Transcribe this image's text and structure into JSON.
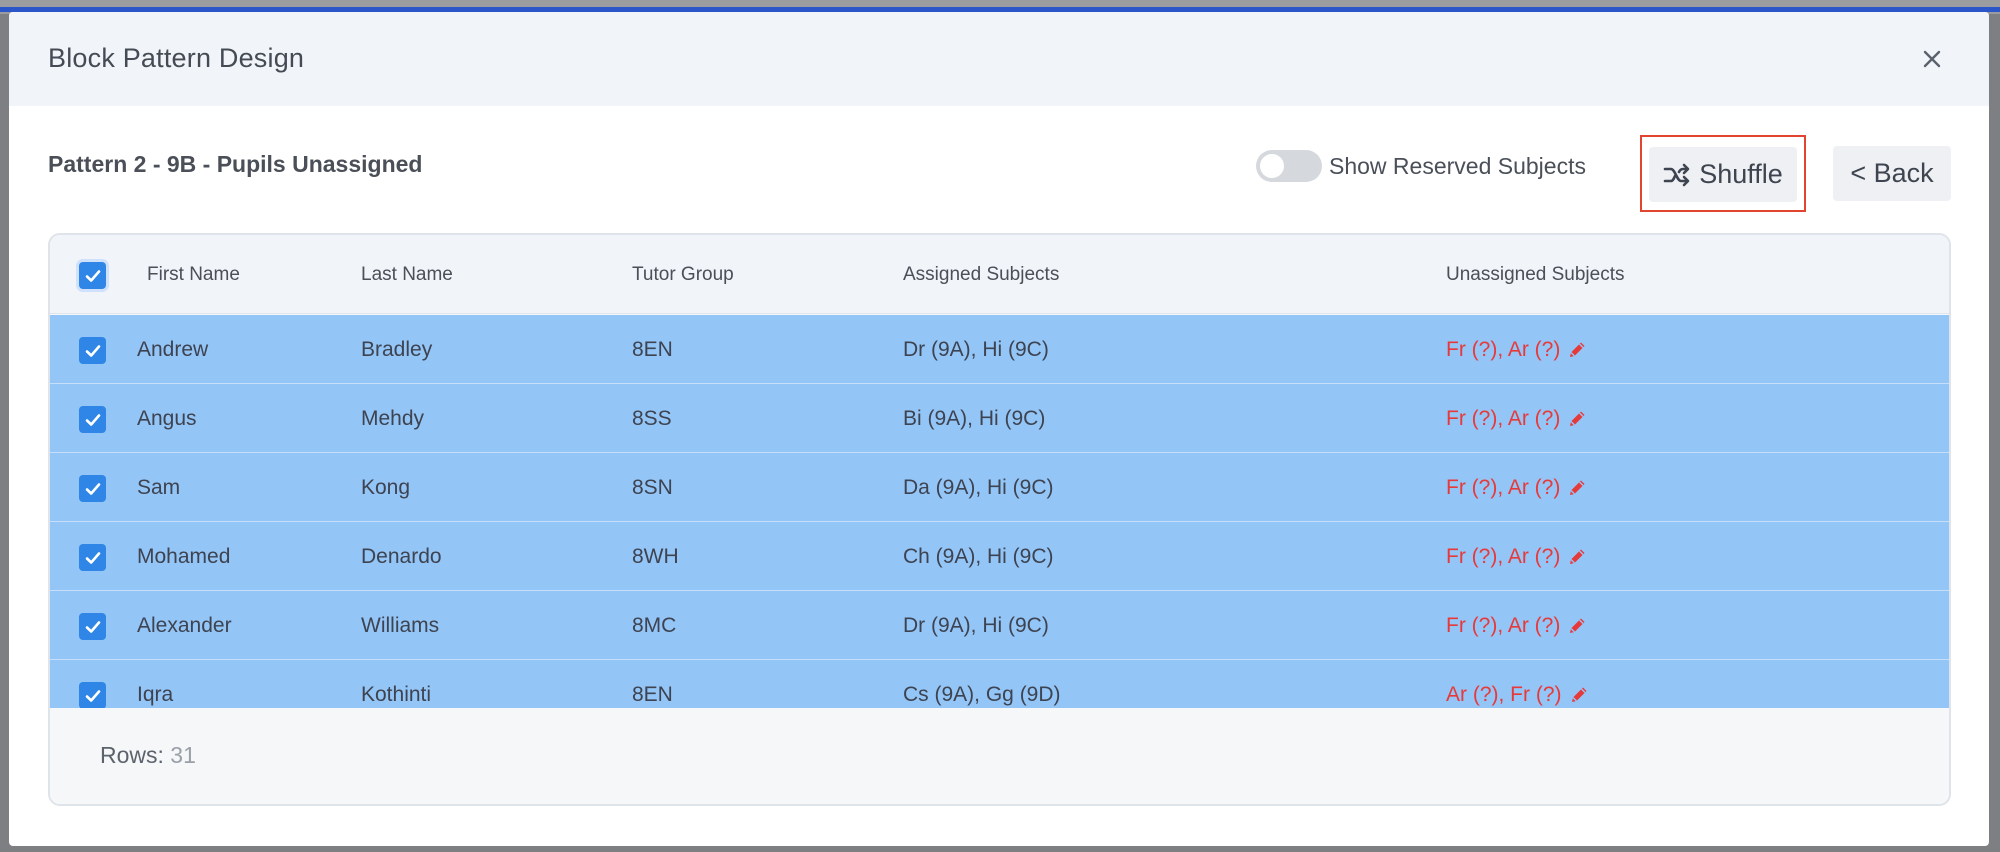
{
  "modal": {
    "title": "Block Pattern Design",
    "subtitle": "Pattern 2 - 9B - Pupils Unassigned",
    "toggle_label": "Show Reserved Subjects",
    "shuffle_label": "Shuffle",
    "back_label": "< Back"
  },
  "table": {
    "headers": {
      "first_name": "First Name",
      "last_name": "Last Name",
      "tutor_group": "Tutor Group",
      "assigned": "Assigned Subjects",
      "unassigned": "Unassigned Subjects"
    },
    "rows": [
      {
        "first": "Andrew",
        "last": "Bradley",
        "tutor": "8EN",
        "assigned": "Dr (9A), Hi (9C)",
        "unassigned": "Fr (?), Ar (?)"
      },
      {
        "first": "Angus",
        "last": "Mehdy",
        "tutor": "8SS",
        "assigned": "Bi (9A), Hi (9C)",
        "unassigned": "Fr (?), Ar (?)"
      },
      {
        "first": "Sam",
        "last": "Kong",
        "tutor": "8SN",
        "assigned": "Da (9A), Hi (9C)",
        "unassigned": "Fr (?), Ar (?)"
      },
      {
        "first": "Mohamed",
        "last": "Denardo",
        "tutor": "8WH",
        "assigned": "Ch (9A), Hi (9C)",
        "unassigned": "Fr (?), Ar (?)"
      },
      {
        "first": "Alexander",
        "last": "Williams",
        "tutor": "8MC",
        "assigned": "Dr (9A), Hi (9C)",
        "unassigned": "Fr (?), Ar (?)"
      },
      {
        "first": "Iqra",
        "last": "Kothinti",
        "tutor": "8EN",
        "assigned": "Cs (9A), Gg (9D)",
        "unassigned": "Ar (?), Fr (?)"
      }
    ],
    "footer": {
      "rows_label": "Rows:",
      "rows_value": "31"
    }
  },
  "colors": {
    "accent": "#2b56c9",
    "selected_row": "#94c5f7",
    "checkbox": "#2f86e6",
    "unassigned_text": "#e63a3a",
    "highlight_outline": "#e2452f"
  },
  "icons": {
    "close": "close-icon",
    "shuffle": "shuffle-icon",
    "check": "check-icon",
    "edit": "pencil-icon"
  }
}
